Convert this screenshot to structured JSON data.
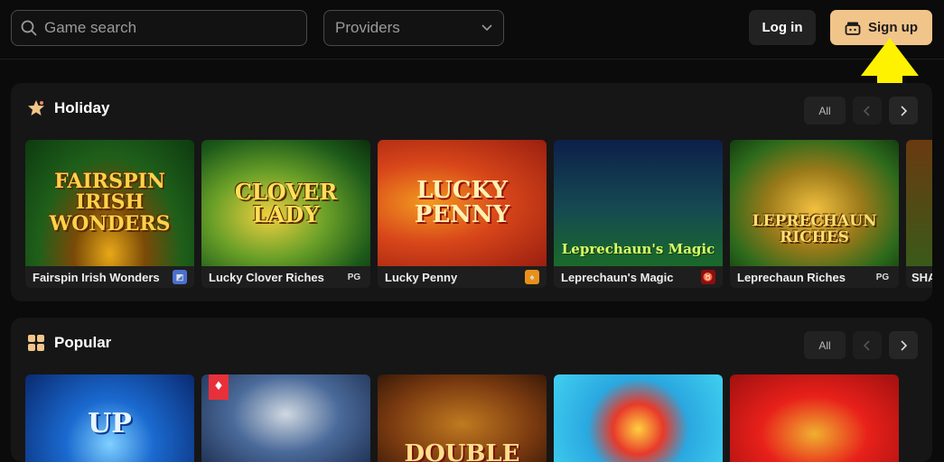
{
  "header": {
    "search_placeholder": "Game search",
    "providers_label": "Providers",
    "login_label": "Log in",
    "signup_label": "Sign up"
  },
  "sections": [
    {
      "title": "Holiday",
      "all_label": "All",
      "games": [
        {
          "name": "Fairspin Irish Wonders",
          "art": "FAIRSPIN\nIRISH WONDERS",
          "provider_icon": "fairspin-icon"
        },
        {
          "name": "Lucky Clover Riches",
          "art": "CLOVER\nLADY",
          "provider_icon": "pg"
        },
        {
          "name": "Lucky Penny",
          "art": "LUCKY\nPENNY",
          "provider_icon": "shield-icon"
        },
        {
          "name": "Leprechaun's Magic",
          "art": "Leprechaun's Magic",
          "provider_icon": "red-devil-icon"
        },
        {
          "name": "Leprechaun Riches",
          "art": "LEPRECHAUN\nRICHES",
          "provider_icon": "pg"
        },
        {
          "name": "SHA",
          "art": "",
          "provider_icon": ""
        }
      ]
    },
    {
      "title": "Popular",
      "all_label": "All",
      "games": [
        {
          "art": "UP"
        },
        {
          "art": ""
        },
        {
          "art": "DOUBLE"
        },
        {
          "art": ""
        },
        {
          "art": ""
        }
      ]
    }
  ],
  "colors": {
    "signup_bg": "#f1c48a",
    "arrow": "#fff200",
    "section_bg": "#161616"
  }
}
